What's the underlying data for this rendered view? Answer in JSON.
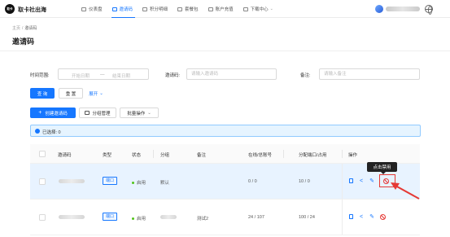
{
  "app": {
    "brand": "取卡社出海",
    "logo_text": "取卡"
  },
  "nav": [
    {
      "label": "仪表盘",
      "active": false
    },
    {
      "label": "邀请码",
      "active": true
    },
    {
      "label": "积分明细",
      "active": false
    },
    {
      "label": "套餐包",
      "active": false
    },
    {
      "label": "账户充值",
      "active": false
    },
    {
      "label": "下载中心",
      "active": false
    }
  ],
  "breadcrumb": {
    "home": "主页",
    "sep": "/",
    "current": "邀请码"
  },
  "page_title": "邀请码",
  "filter": {
    "time_label": "时间范围:",
    "start_placeholder": "开始日期",
    "range_sep": "—",
    "end_placeholder": "结束日期",
    "code_label": "邀请码:",
    "code_placeholder": "请输入邀请码",
    "remark_label": "备注:",
    "remark_placeholder": "请输入备注",
    "query_button": "查 询",
    "reset_button": "重 置",
    "expand_link": "展开",
    "expand_caret": "⌄"
  },
  "toolbar": {
    "create_button": "创建邀请码",
    "group_button": "分组管理",
    "batch_button": "批量操作",
    "batch_caret": "⌄"
  },
  "alert": {
    "text": "已选择: 0"
  },
  "table": {
    "headers": {
      "code": "邀请码",
      "type": "类型",
      "status": "状态",
      "group": "分组",
      "remark": "备注",
      "online_total": "在线/总账号",
      "quota": "分配端口/占用",
      "actions": "操作"
    },
    "rows": [
      {
        "type": "端口",
        "status": "启用",
        "group": "默认",
        "remark": "",
        "online_total": "0 / 0",
        "quota": "10 / 0"
      },
      {
        "type": "端口",
        "status": "启用",
        "group": "",
        "remark": "测试2",
        "online_total": "24 / 107",
        "quota": "100 / 24"
      }
    ]
  },
  "tooltip": {
    "text": "点击禁用"
  },
  "colors": {
    "primary": "#1677ff",
    "danger": "#e53935",
    "success": "#52c41a"
  },
  "icons": [
    "doc-icon",
    "share-icon",
    "edit-icon",
    "ban-icon",
    "plus-icon",
    "folder-icon",
    "globe-icon"
  ]
}
